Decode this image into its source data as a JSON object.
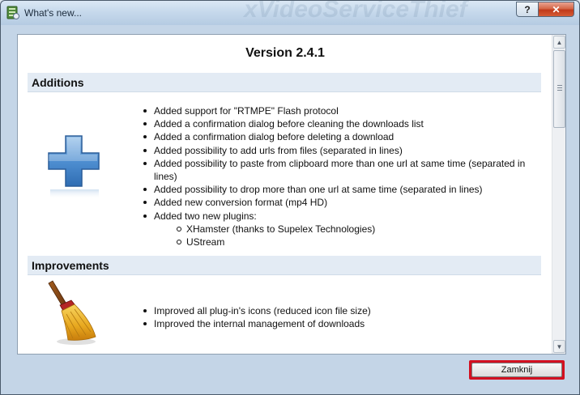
{
  "window": {
    "title": "What's new...",
    "background_title": "xVideoServiceThief",
    "help_label": "?",
    "close_label": "✕"
  },
  "doc": {
    "version_title": "Version 2.4.1",
    "sections": [
      {
        "title": "Additions",
        "icon": "plus-icon",
        "items": [
          "Added support for \"RTMPE\" Flash protocol",
          "Added a confirmation dialog before cleaning the downloads list",
          "Added a confirmation dialog before deleting a download",
          "Added possibility to add urls from files (separated in lines)",
          "Added possibility to paste from clipboard more than one url at same time (separated in lines)",
          "Added possibility to drop more than one url at same time (separated in lines)",
          "Added new conversion format (mp4 HD)",
          "Added two new plugins:"
        ],
        "subitems": [
          "XHamster (thanks to Supelex Technologies)",
          "UStream"
        ]
      },
      {
        "title": "Improvements",
        "icon": "broom-icon",
        "items": [
          "Improved all plug-in's icons (reduced icon file size)",
          "Improved the internal management of downloads"
        ]
      }
    ]
  },
  "footer": {
    "close_button_label": "Zamknij",
    "highlight_color": "#d31020"
  }
}
